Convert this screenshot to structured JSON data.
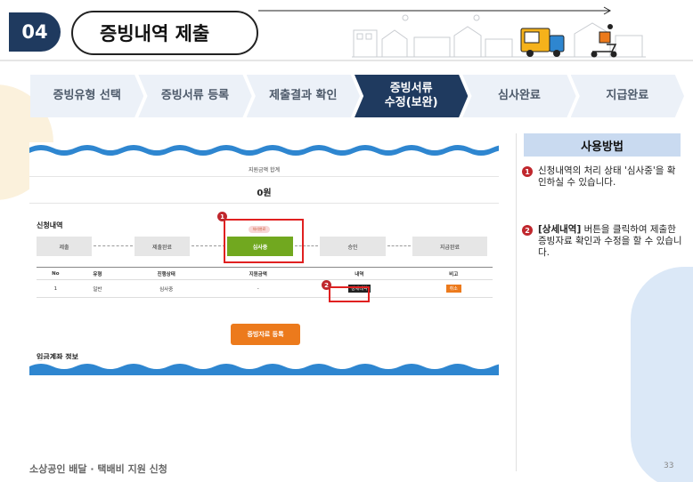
{
  "header": {
    "step_number": "04",
    "title": "증빙내역 제출"
  },
  "steps": [
    {
      "label": "증빙유형 선택",
      "active": false
    },
    {
      "label": "증빙서류 등록",
      "active": false
    },
    {
      "label": "제출결과 확인",
      "active": false
    },
    {
      "label": "증빙서류\n수정(보완)",
      "active": true
    },
    {
      "label": "심사완료",
      "active": false
    },
    {
      "label": "지급완료",
      "active": false
    }
  ],
  "screenshot": {
    "support_title": "지원금액 합계",
    "support_amount": "0원",
    "apply_label": "신청내역",
    "status_tag": "처리완료",
    "progress_steps": [
      "제출",
      "제출완료",
      "심사중",
      "승인",
      "지급완료"
    ],
    "current_step": "심사중",
    "table": {
      "headers": [
        "No",
        "유형",
        "진행상태",
        "지원금액",
        "내역",
        "비고"
      ],
      "rows": [
        {
          "no": "1",
          "type": "일반",
          "status": "심사중",
          "amount": "-",
          "detail": "상세내역",
          "note": "취소"
        }
      ]
    },
    "register_button": "증빙자료 등록",
    "account_label": "입금계좌 정보",
    "markers": [
      "1",
      "2"
    ]
  },
  "usage": {
    "title": "사용방법",
    "items": [
      {
        "num": "1",
        "prefix": "",
        "text": "신청내역의 처리 상태 '심사중'을 확인하실 수 있습니다."
      },
      {
        "num": "2",
        "prefix": "[상세내역]",
        "text": " 버튼을 클릭하여 제출한 증빙자료 확인과 수정을 할 수 있습니다."
      }
    ]
  },
  "footer": {
    "text": "소상공인 배달 · 택배비 지원 신청",
    "page_number": "33"
  },
  "colors": {
    "navy": "#1f3a5f",
    "light_blue": "#ecf1f8",
    "panel_blue": "#c9daf0",
    "green": "#71a81f",
    "orange": "#ec7a1c",
    "red": "#c0272d",
    "wave_blue": "#2e86d0"
  }
}
